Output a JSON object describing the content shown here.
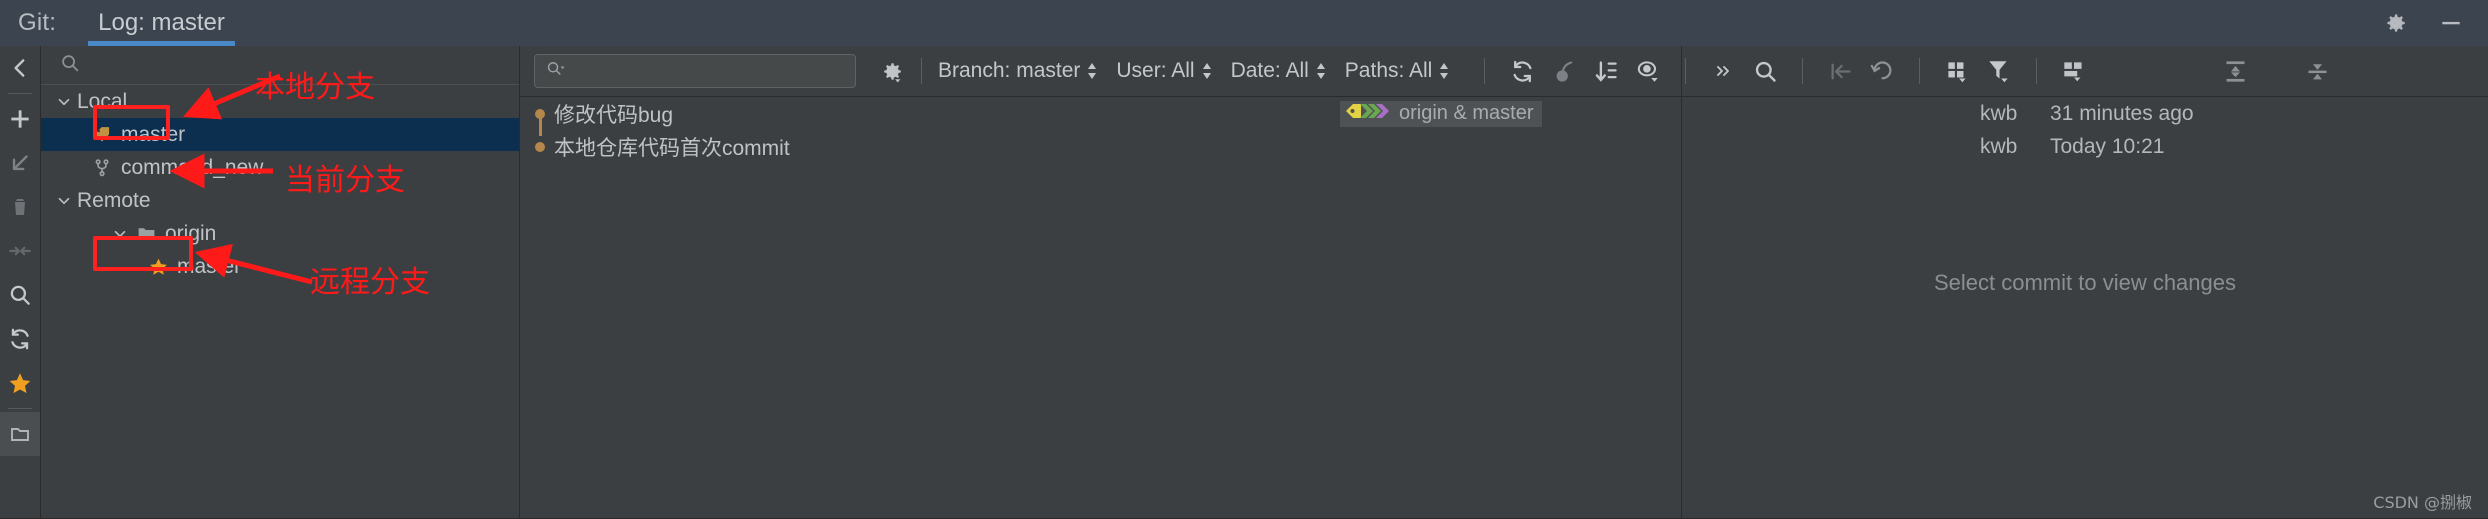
{
  "header": {
    "git_label": "Git:",
    "tab_label": "Log: master",
    "accent_color": "#4a88c7",
    "settings_icon": "gear-icon",
    "minimize_icon": "minimize-icon"
  },
  "rail": {
    "items": [
      {
        "name": "collapse-back-icon",
        "glyph": "chevron-left"
      },
      {
        "name": "separator",
        "glyph": "separator"
      },
      {
        "name": "new-branch-icon",
        "glyph": "plus"
      },
      {
        "name": "checkout-icon",
        "glyph": "arrow-down-left"
      },
      {
        "name": "delete-branch-icon",
        "glyph": "trash"
      },
      {
        "name": "merge-icon",
        "glyph": "merge-arrows"
      },
      {
        "name": "search-icon",
        "glyph": "magnifier"
      },
      {
        "name": "refresh-icon",
        "glyph": "refresh"
      },
      {
        "name": "favorite-icon",
        "glyph": "star"
      },
      {
        "name": "separator",
        "glyph": "separator"
      },
      {
        "name": "repository-icon",
        "glyph": "folder-open"
      }
    ]
  },
  "branch_tree": {
    "search_placeholder": "",
    "search_icon": "search-icon",
    "nodes": [
      {
        "label": "Local",
        "level": 0,
        "icon": "none",
        "expander": "chevron-down",
        "selected": false
      },
      {
        "label": "master",
        "level": 1,
        "icon": "tag",
        "expander": "none",
        "selected": true
      },
      {
        "label": "command_new",
        "level": 1,
        "icon": "branch",
        "expander": "none",
        "selected": false
      },
      {
        "label": "Remote",
        "level": 0,
        "icon": "none",
        "expander": "chevron-down",
        "selected": false
      },
      {
        "label": "origin",
        "level": 1,
        "icon": "folder",
        "expander": "chevron-down",
        "selected": false
      },
      {
        "label": "master",
        "level": 2,
        "icon": "star",
        "expander": "none",
        "selected": false
      }
    ]
  },
  "toolbar": {
    "search_placeholder": "",
    "search_icon": "search-dropdown-icon",
    "gear_icon": "gear-settings-icon",
    "filters": [
      {
        "name": "branch-filter",
        "label": "Branch: master"
      },
      {
        "name": "user-filter",
        "label": "User: All"
      },
      {
        "name": "date-filter",
        "label": "Date: All"
      },
      {
        "name": "paths-filter",
        "label": "Paths: All"
      }
    ],
    "icons": [
      {
        "name": "refresh-icon",
        "glyph": "refresh"
      },
      {
        "name": "cherry-pick-icon",
        "glyph": "cherry"
      },
      {
        "name": "sort-icon",
        "glyph": "sort-desc"
      },
      {
        "name": "show-details-icon",
        "glyph": "eye-dropdown"
      },
      {
        "name": "expand-more-icon",
        "glyph": "chevrons-right"
      },
      {
        "name": "search-log-icon",
        "glyph": "magnifier"
      },
      {
        "name": "go-to-hash-icon",
        "glyph": "arrow-into"
      },
      {
        "name": "revert-icon",
        "glyph": "undo"
      },
      {
        "name": "columns-icon",
        "glyph": "grid-dropdown"
      },
      {
        "name": "filter-icon",
        "glyph": "funnel-dropdown"
      },
      {
        "name": "layout-icon",
        "glyph": "layout-dropdown"
      }
    ],
    "right_icons": [
      {
        "name": "expand-all-icon",
        "glyph": "expand-vertical"
      },
      {
        "name": "collapse-all-icon",
        "glyph": "collapse-vertical"
      }
    ]
  },
  "commits": {
    "rows": [
      {
        "message": "修改代码bug",
        "refs_label": "origin & master",
        "refs_icon": "tag-branch-labels-icon",
        "author": "kwb",
        "date": "31 minutes ago",
        "has_refs": true
      },
      {
        "message": "本地仓库代码首次commit",
        "refs_label": "",
        "refs_icon": "",
        "author": "kwb",
        "date": "Today 10:21",
        "has_refs": false
      }
    ]
  },
  "details_panel": {
    "empty_text": "Select commit to view changes"
  },
  "annotations": {
    "local_label": "本地分支",
    "current_label": "当前分支",
    "remote_label": "远程分支",
    "color": "#ff1a1a"
  },
  "watermark": {
    "text": "CSDN @捌椒"
  }
}
